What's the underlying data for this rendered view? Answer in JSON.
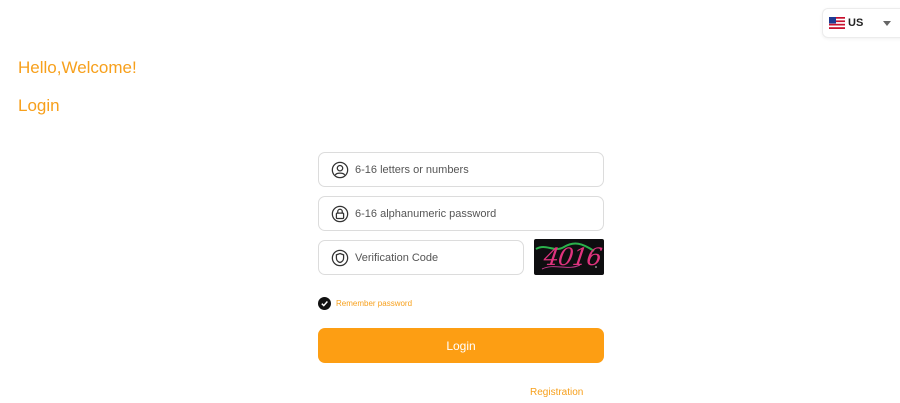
{
  "language": {
    "selected": "US",
    "flag_icon": "us-flag-icon"
  },
  "header": {
    "greeting": "Hello,Welcome!",
    "title": "Login"
  },
  "form": {
    "username": {
      "placeholder": "6-16 letters or numbers",
      "value": "",
      "icon": "user-icon"
    },
    "password": {
      "placeholder": "6-16 alphanumeric password",
      "value": "",
      "icon": "lock-icon"
    },
    "captcha": {
      "placeholder": "Verification Code",
      "value": "",
      "icon": "shield-icon",
      "image_text": "4016"
    },
    "remember": {
      "label": "Remember password",
      "checked": true
    },
    "login_button": "Login",
    "registration_link": "Registration"
  },
  "colors": {
    "accent": "#f7a01c",
    "button": "#fd9e13",
    "captcha_bg": "#0e0e10",
    "captcha_text": "#e0337e"
  }
}
